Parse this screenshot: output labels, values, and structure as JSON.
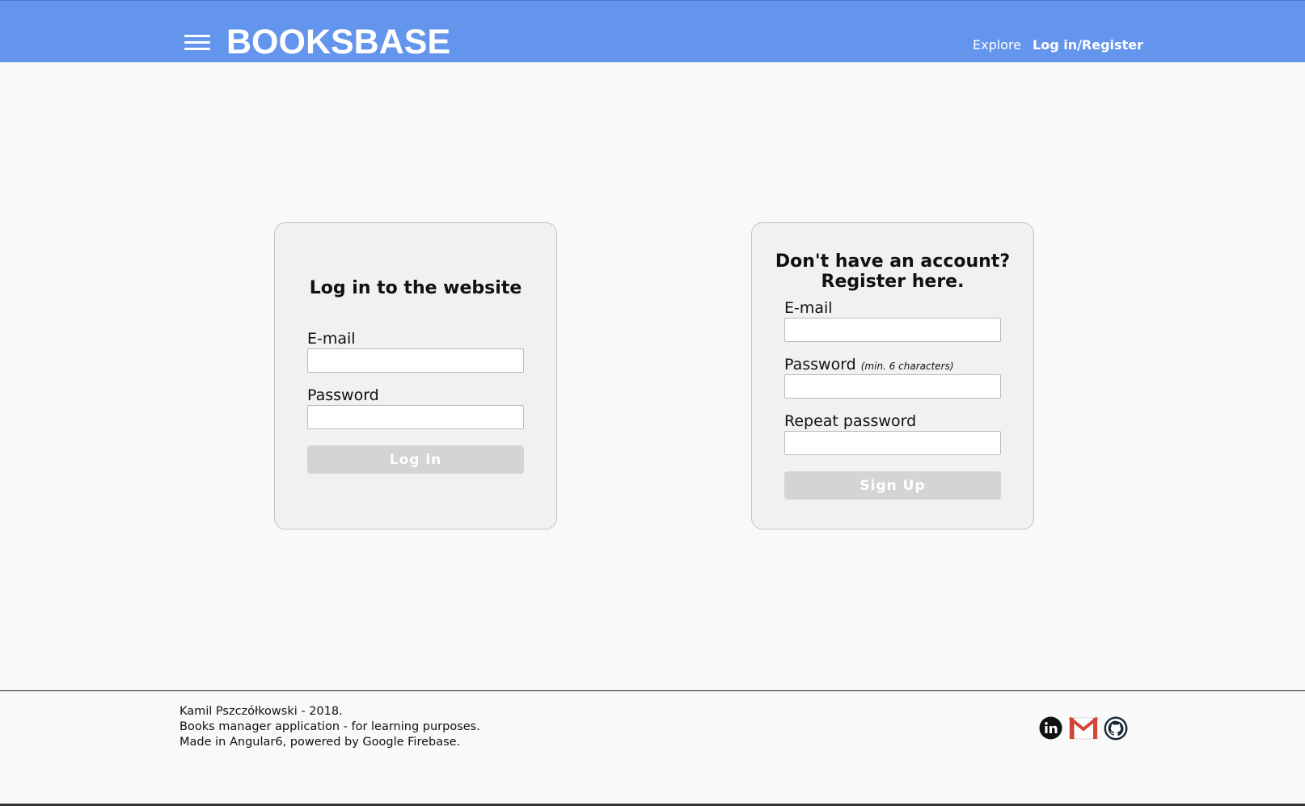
{
  "header": {
    "brand": "BOOKSBASE",
    "nav": {
      "explore": "Explore",
      "login_register": "Log in/Register"
    },
    "bg_color": "#6495ed"
  },
  "login_card": {
    "title": "Log in to the website",
    "email_label": "E-mail",
    "email_value": "",
    "password_label": "Password",
    "password_value": "",
    "submit_label": "Log in"
  },
  "register_card": {
    "title_line1": "Don't have an account?",
    "title_line2": "Register here.",
    "email_label": "E-mail",
    "email_value": "",
    "password_label": "Password",
    "password_hint": "(min. 6 characters)",
    "password_value": "",
    "repeat_password_label": "Repeat password",
    "repeat_password_value": "",
    "submit_label": "Sign Up"
  },
  "footer": {
    "line1": "Kamil Pszczółkowski - 2018.",
    "line2": "Books manager application - for learning purposes.",
    "line3": "Made in Angular6, powered by Google Firebase.",
    "social_icons": [
      "linkedin-icon",
      "gmail-icon",
      "github-icon"
    ]
  }
}
